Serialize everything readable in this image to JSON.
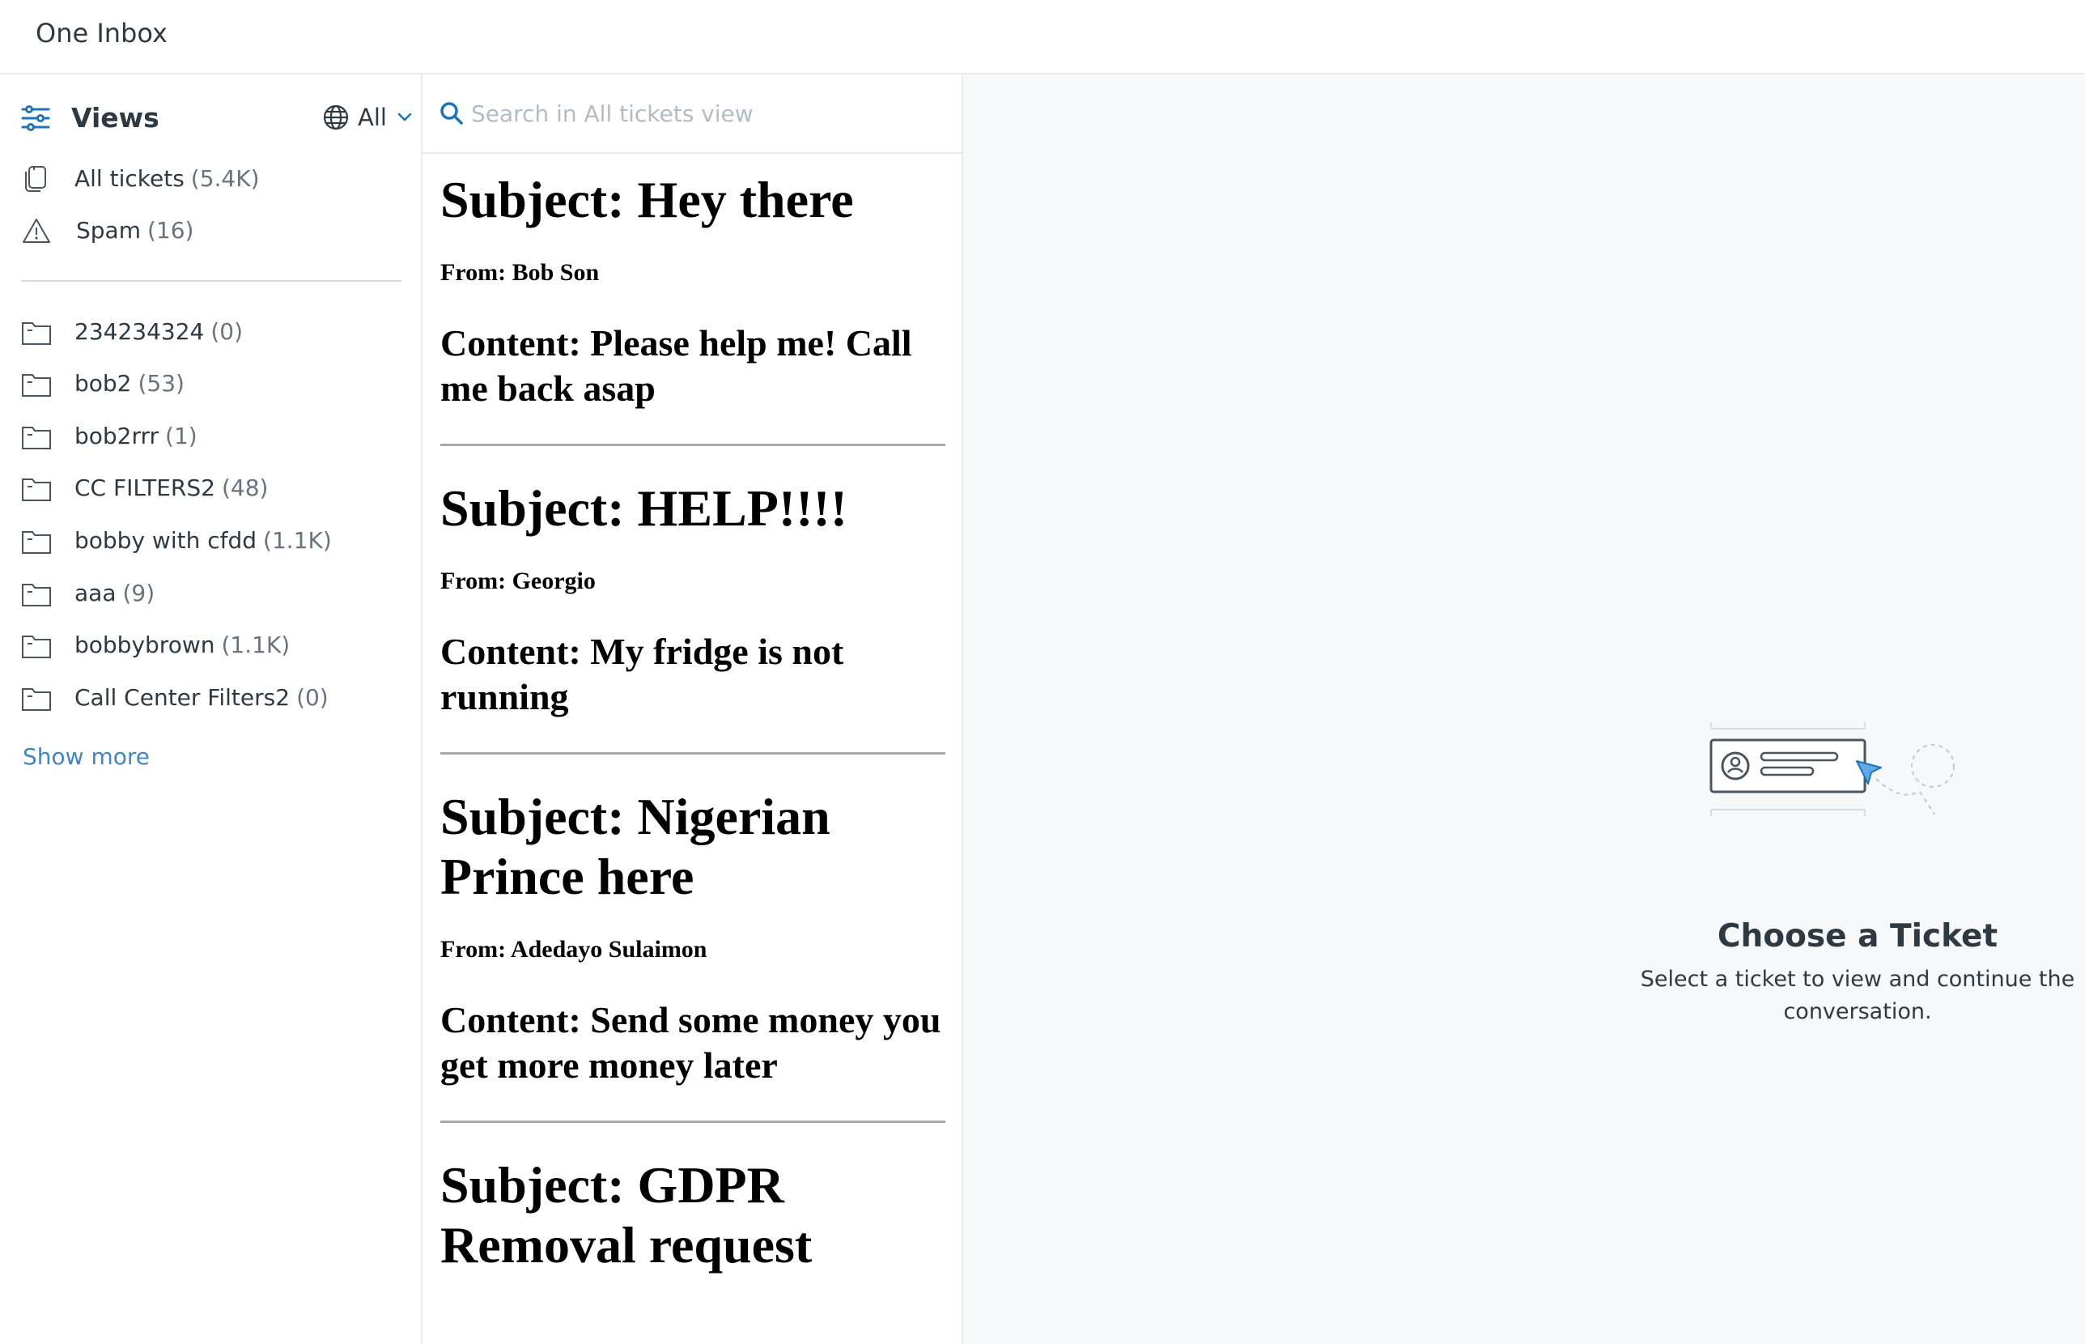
{
  "app": {
    "title": "One Inbox"
  },
  "sidebar": {
    "views_title": "Views",
    "scope_label": "All",
    "system_views": [
      {
        "label": "All tickets",
        "count": "(5.4K)",
        "icon": "copy-icon"
      },
      {
        "label": "Spam",
        "count": "(16)",
        "icon": "warning-icon"
      }
    ],
    "folders": [
      {
        "label": "234234324",
        "count": "(0)"
      },
      {
        "label": "bob2",
        "count": "(53)"
      },
      {
        "label": "bob2rrr",
        "count": "(1)"
      },
      {
        "label": "CC FILTERS2",
        "count": "(48)"
      },
      {
        "label": "bobby with cfdd",
        "count": "(1.1K)"
      },
      {
        "label": "aaa",
        "count": "(9)"
      },
      {
        "label": "bobbybrown",
        "count": "(1.1K)"
      },
      {
        "label": "Call Center Filters2",
        "count": "(0)"
      }
    ],
    "show_more": "Show more"
  },
  "search": {
    "placeholder": "Search in All tickets view"
  },
  "tickets": [
    {
      "subject": "Subject: Hey there",
      "from": "From: Bob Son",
      "content": "Content: Please help me! Call me back asap"
    },
    {
      "subject": "Subject: HELP!!!!",
      "from": "From: Georgio",
      "content": "Content: My fridge is not running"
    },
    {
      "subject": "Subject: Nigerian Prince here",
      "from": "From: Adedayo Sulaimon",
      "content": "Content: Send some money you get more money later"
    },
    {
      "subject": "Subject: GDPR Removal request",
      "from": "",
      "content": ""
    }
  ],
  "empty_state": {
    "title": "Choose a Ticket",
    "subtitle": "Select a ticket to view and continue the conversation."
  },
  "colors": {
    "accent": "#1f73b7",
    "icon_blue": "#5ea9e6",
    "text": "#2f3941",
    "muted": "#68737d",
    "detail_bg": "#f6f8fa"
  }
}
